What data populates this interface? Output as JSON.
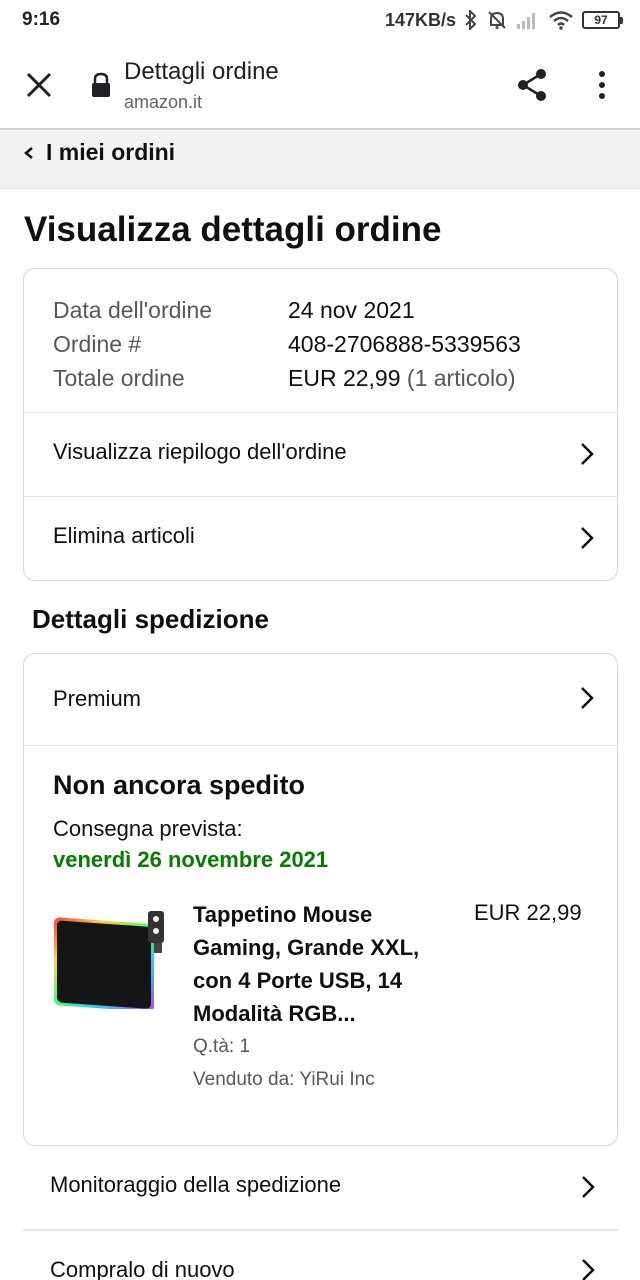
{
  "status_bar": {
    "time": "9:16",
    "speed": "147KB/s",
    "battery": "97"
  },
  "browser": {
    "title": "Dettagli ordine",
    "url": "amazon.it"
  },
  "breadcrumb": {
    "label": "I miei ordini"
  },
  "page": {
    "title": "Visualizza dettagli ordine"
  },
  "order_info": {
    "rows": [
      {
        "label": "Data dell'ordine",
        "value": "24 nov 2021"
      },
      {
        "label": "Ordine #",
        "value": "408-2706888-5339563"
      },
      {
        "label": "Totale ordine",
        "value": "EUR 22,99",
        "extra": "(1 articolo)"
      }
    ],
    "summary_link": "Visualizza riepilogo dell'ordine",
    "remove_link": "Elimina articoli"
  },
  "shipping": {
    "section_title": "Dettagli spedizione",
    "service": "Premium",
    "status": "Non ancora spedito",
    "delivery_label": "Consegna prevista:",
    "delivery_date": "venerdì 26 novembre 2021",
    "accent_color": "#067d00",
    "product": {
      "title": "Tappetino Mouse Gaming, Grande XXL, con 4 Porte USB, 14 Modalità RGB...",
      "price": "EUR 22,99",
      "qty": "Q.tà: 1",
      "seller": "Venduto da: YiRui Inc"
    }
  },
  "actions": {
    "track": "Monitoraggio della spedizione",
    "buy_again": "Compralo di nuovo"
  }
}
